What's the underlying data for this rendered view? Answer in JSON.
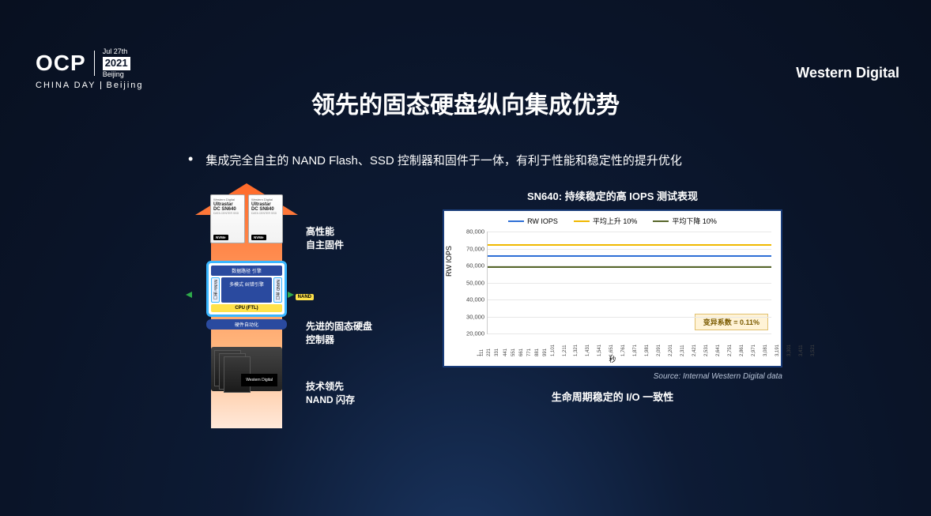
{
  "header": {
    "logo_main": "OCP",
    "logo_date_top": "Jul 27th",
    "logo_year": "2021",
    "logo_city": "Beijing",
    "logo_sub": "CHINA DAY",
    "brand_right": "Western Digital"
  },
  "title": "领先的固态硬盘纵向集成优势",
  "bullet": "集成完全自主的 NAND Flash、SSD 控制器和固件于一体，有利于性能和稳定性的提升优化",
  "diagram": {
    "ssd_brand": "Western Digital",
    "ssd_product": "Ultrastar",
    "ssd_model_a": "DC SN640",
    "ssd_model_b": "DC SN840",
    "ssd_sub": "DATA CENTER SSD",
    "ssd_nvme": "NVMe",
    "label1": "高性能\n自主固件",
    "label2": "先进的固态硬盘\n控制器",
    "label3": "技术领先\nNAND 闪存",
    "ctrl_top": "数据路径\n引擎",
    "ctrl_side_left": "NVMe 接口",
    "ctrl_side_right": "NAND 接口",
    "ctrl_center": "多模式\n纠错引擎",
    "ctrl_cpu": "CPU (FTL)",
    "ctrl_bottom": "硬件自动化",
    "nand_pill": "NAND",
    "wd_chip": "Western Digital"
  },
  "chart_data": {
    "type": "line",
    "title": "SN640:  持续稳定的高 IOPS 测试表现",
    "ylabel": "RW IOPS",
    "xlabel": "秒",
    "ylim": [
      20000,
      80000
    ],
    "yticks": [
      20000,
      30000,
      40000,
      50000,
      60000,
      70000,
      80000
    ],
    "x": [
      1,
      111,
      221,
      331,
      441,
      551,
      661,
      771,
      881,
      991,
      1101,
      1211,
      1321,
      1431,
      1541,
      1651,
      1761,
      1871,
      1981,
      2091,
      2201,
      2311,
      2421,
      2531,
      2641,
      2751,
      2861,
      2971,
      3081,
      3191,
      3301,
      3411,
      3521
    ],
    "series": [
      {
        "name": "RW IOPS",
        "color": "#2e6fd6",
        "value": 66000
      },
      {
        "name": "平均上升 10%",
        "color": "#f0b800",
        "value": 72500
      },
      {
        "name": "平均下降 10%",
        "color": "#57662a",
        "value": 59500
      }
    ],
    "variance_box": "变异系数 = 0.11%",
    "source": "Source: Internal Western Digital data",
    "caption": "生命周期稳定的 I/O 一致性"
  }
}
